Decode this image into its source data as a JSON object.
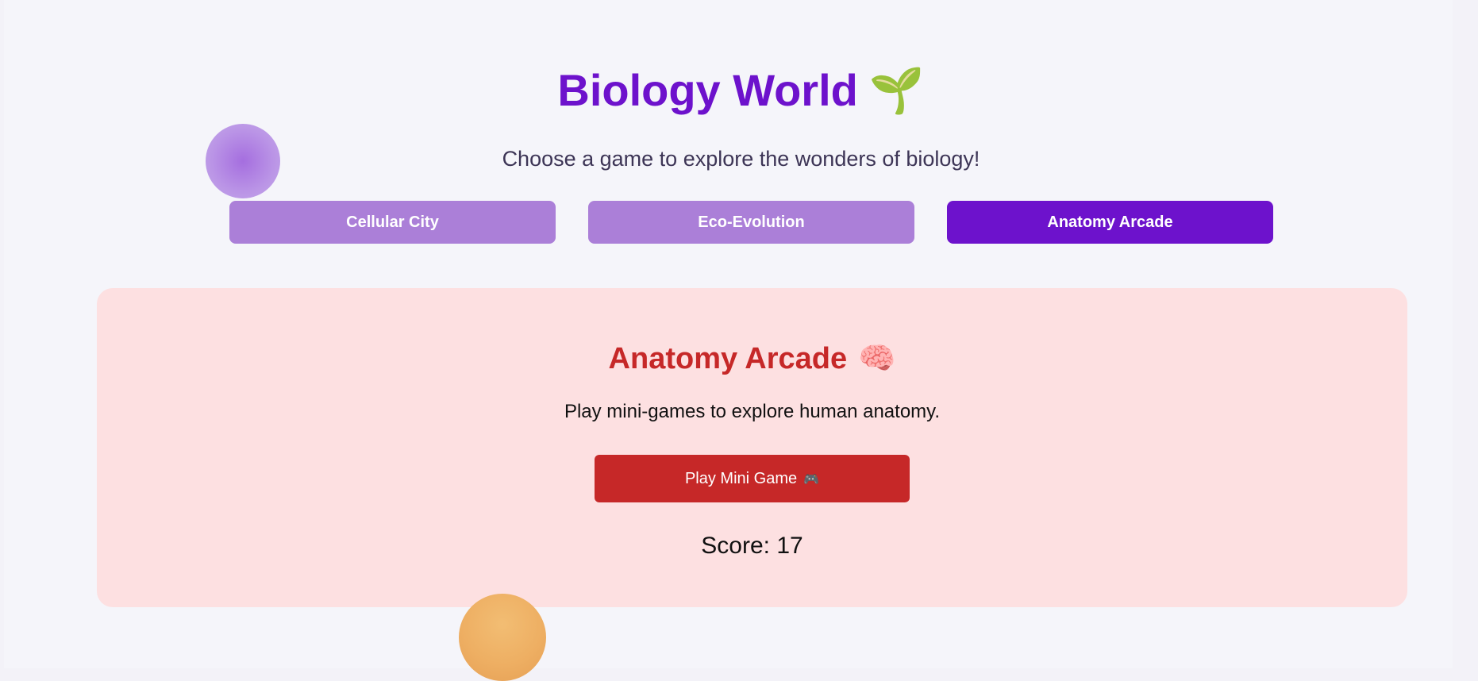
{
  "header": {
    "title": "Biology World",
    "title_icon": "🌱",
    "subtitle": "Choose a game to explore the wonders of biology!"
  },
  "tabs": [
    {
      "label": "Cellular City",
      "active": false
    },
    {
      "label": "Eco-Evolution",
      "active": false
    },
    {
      "label": "Anatomy Arcade",
      "active": true
    }
  ],
  "game_card": {
    "title": "Anatomy Arcade",
    "title_icon": "🧠",
    "description": "Play mini-games to explore human anatomy.",
    "play_button": {
      "label": "Play Mini Game",
      "icon": "🎮"
    },
    "score_text": "Score: 17"
  },
  "colors": {
    "brand_purple": "#6d12cc",
    "tab_inactive": "#ab7fd8",
    "card_background": "#fde0e1",
    "accent_red": "#c62828",
    "page_background": "#f5f5fa"
  },
  "icons": {
    "title_icon": "seedling-icon",
    "card_title_icon": "brain-icon",
    "play_button_icon": "game-controller-icon"
  }
}
